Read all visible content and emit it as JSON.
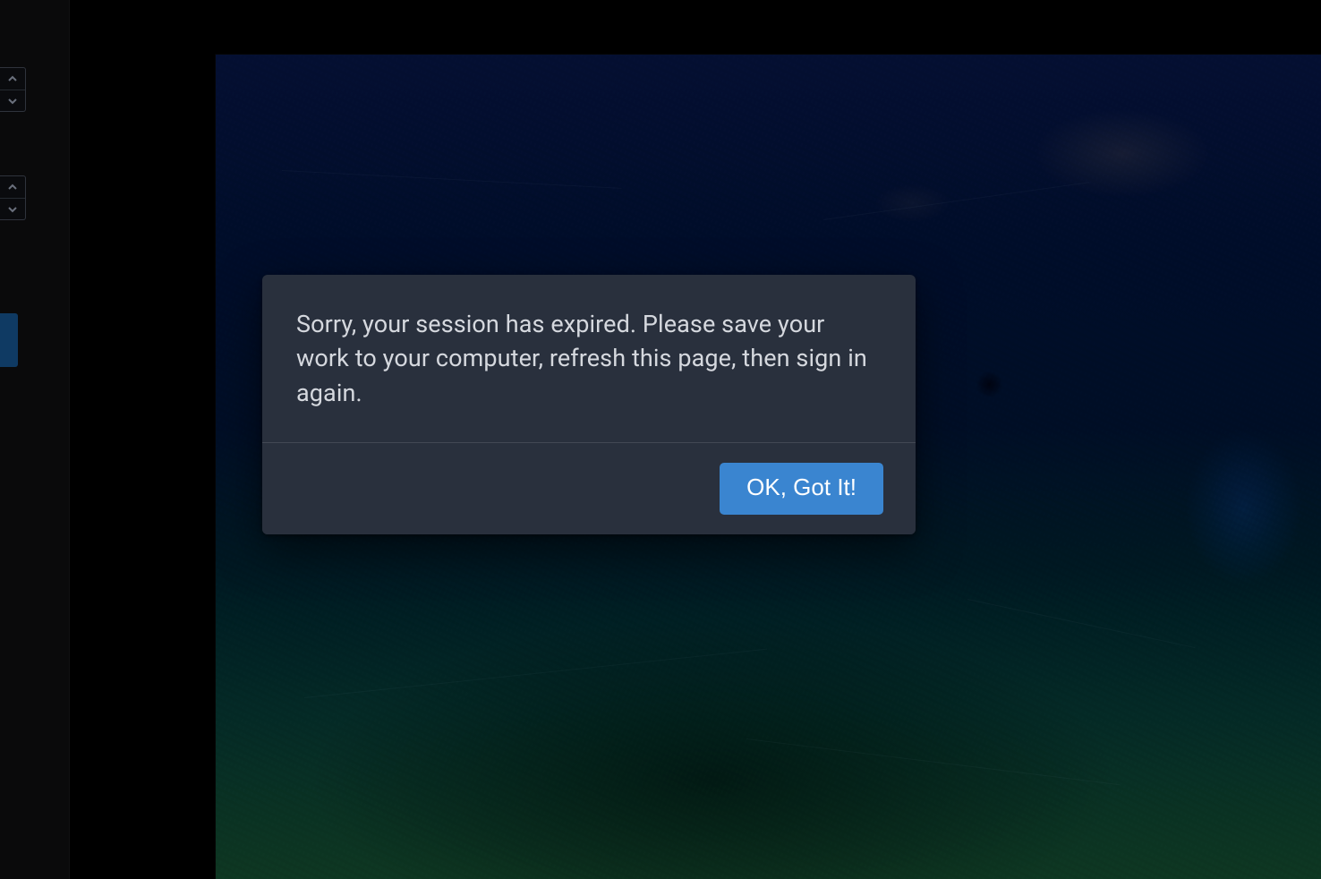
{
  "dialog": {
    "message": "Sorry, your session has expired. Please save your work to your computer, refresh this page, then sign in again.",
    "confirm_label": "OK, Got It!"
  },
  "colors": {
    "dialog_bg": "#29303d",
    "dialog_text": "#d5d8de",
    "button_bg": "#3a85d0",
    "button_text": "#ffffff",
    "active_tab": "#0f3a63"
  }
}
